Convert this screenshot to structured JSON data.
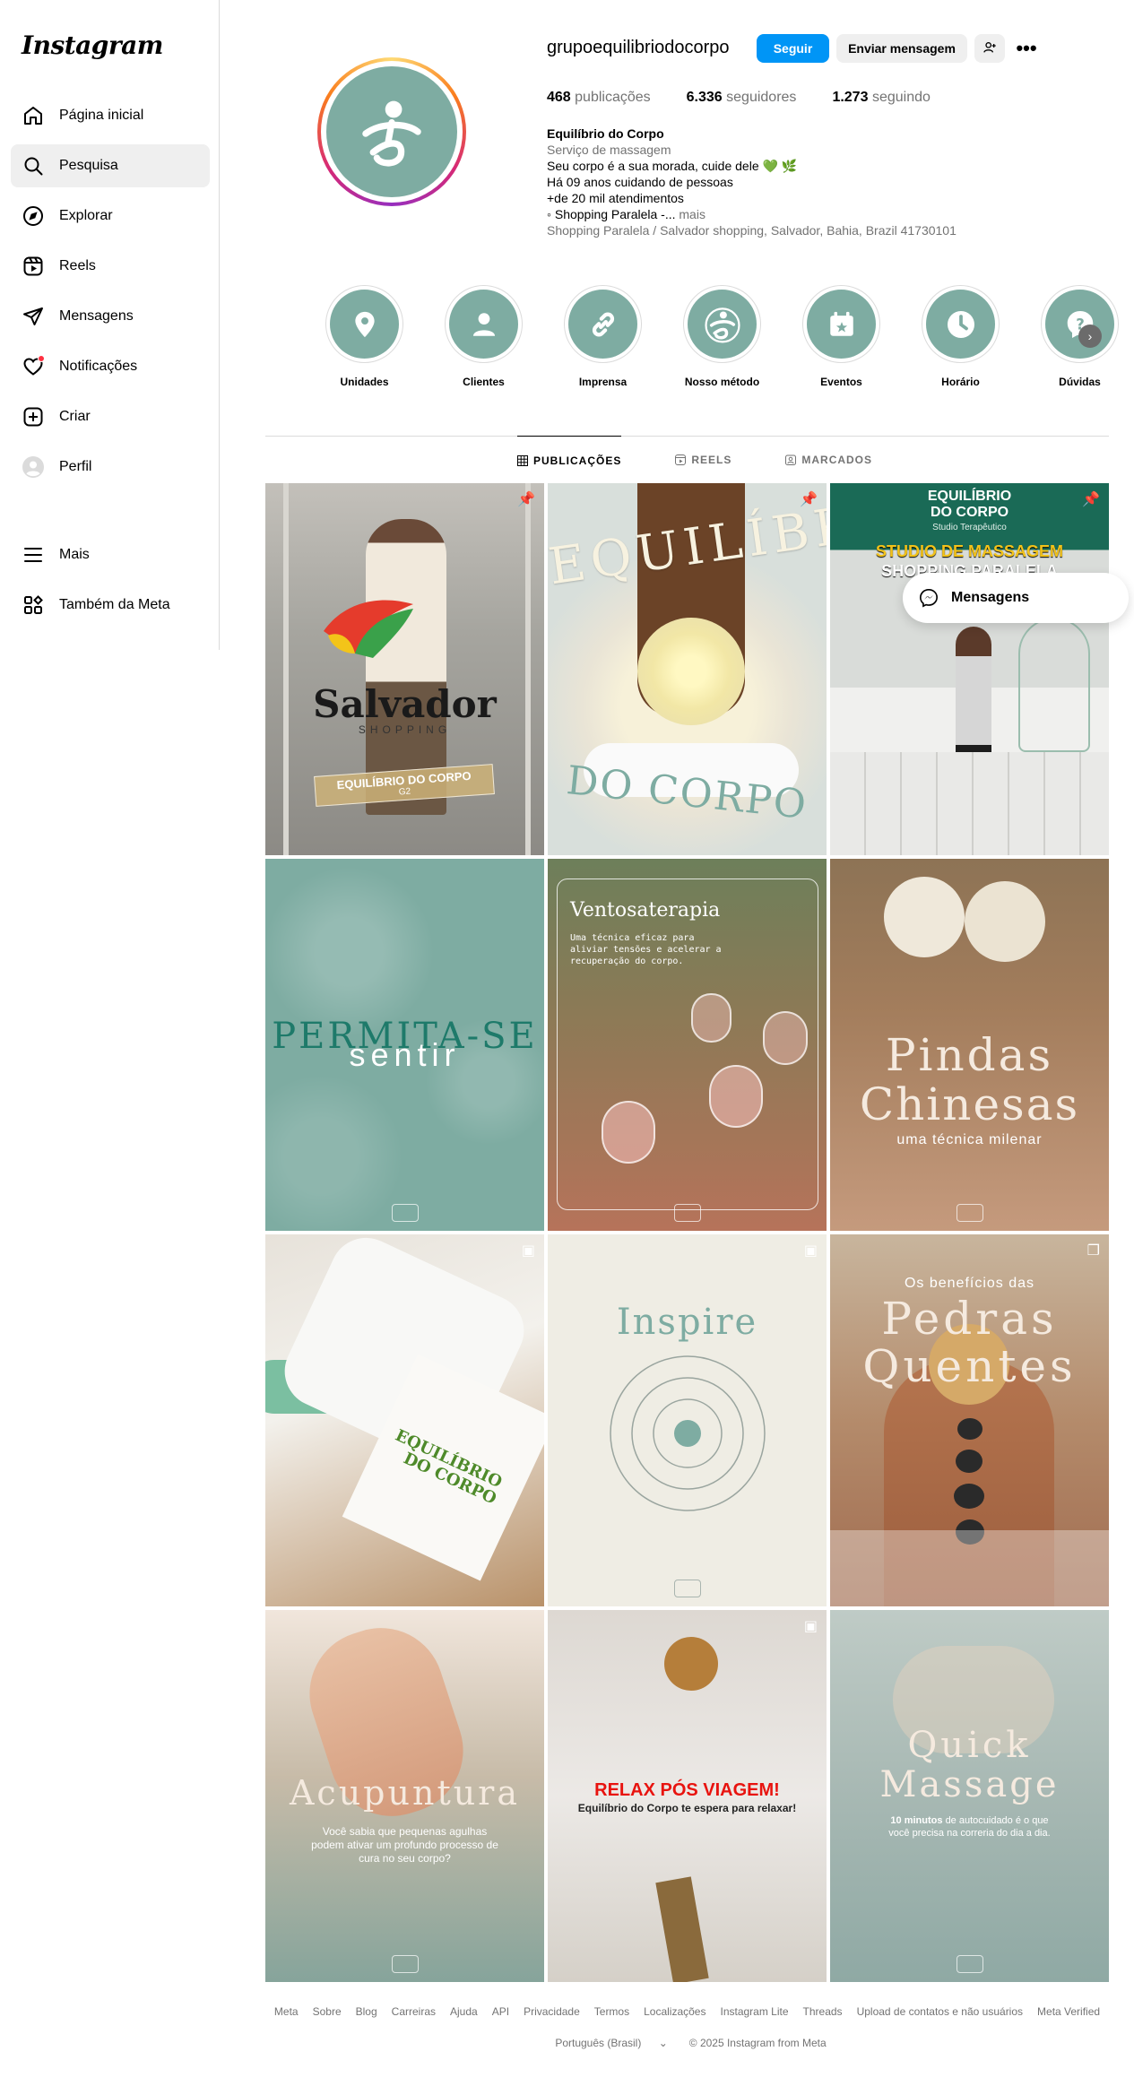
{
  "sidebar": {
    "logo": "Instagram",
    "items": [
      {
        "label": "Página inicial"
      },
      {
        "label": "Pesquisa"
      },
      {
        "label": "Explorar"
      },
      {
        "label": "Reels"
      },
      {
        "label": "Mensagens"
      },
      {
        "label": "Notificações"
      },
      {
        "label": "Criar"
      },
      {
        "label": "Perfil"
      }
    ],
    "bottom": [
      {
        "label": "Mais"
      },
      {
        "label": "Também da Meta"
      }
    ]
  },
  "profile": {
    "username": "grupoequilibriodocorpo",
    "follow_label": "Seguir",
    "message_label": "Enviar mensagem",
    "more_label": "•••",
    "stats": {
      "posts_count": "468",
      "posts_label": "publicações",
      "followers_count": "6.336",
      "followers_label": "seguidores",
      "following_count": "1.273",
      "following_label": "seguindo"
    },
    "bio": {
      "name": "Equilíbrio do Corpo",
      "category": "Serviço de massagem",
      "line1": "Seu corpo é a sua morada, cuide dele 💚 🌿",
      "line2": "Há 09 anos cuidando de pessoas",
      "line3": "+de 20 mil atendimentos",
      "line4": "◦ Shopping Paralela -...",
      "more": "mais",
      "address": "Shopping Paralela / Salvador shopping, Salvador, Bahia, Brazil 41730101"
    }
  },
  "highlights": [
    {
      "label": "Unidades",
      "icon": "location-pin-icon"
    },
    {
      "label": "Clientes",
      "icon": "person-icon"
    },
    {
      "label": "Imprensa",
      "icon": "link-icon"
    },
    {
      "label": "Nosso método",
      "icon": "brand-logo-icon"
    },
    {
      "label": "Eventos",
      "icon": "calendar-star-icon"
    },
    {
      "label": "Horário",
      "icon": "clock-icon"
    },
    {
      "label": "Dúvidas",
      "icon": "question-bubble-icon"
    }
  ],
  "tabs": [
    {
      "label": "PUBLICAÇÕES"
    },
    {
      "label": "REELS"
    },
    {
      "label": "MARCADOS"
    }
  ],
  "posts": {
    "p1": {
      "brand": "Salvador",
      "sub": "SHOPPING",
      "badge": "EQUILÍBRIO DO CORPO",
      "badge_sub": "G2"
    },
    "p2": {
      "top": "EQUILÍBRIO",
      "bottom": "DO CORPO"
    },
    "p3": {
      "top1": "EQUILÍBRIO",
      "top2": "DO CORPO",
      "top3": "Studio Terapêutico",
      "banner1": "STUDIO DE MASSAGEM",
      "banner2": "SHOPPING PARALELA"
    },
    "p4": {
      "t1": "PERMITA-SE",
      "t2": "sentir"
    },
    "p5": {
      "title": "Ventosaterapia",
      "desc": "Uma técnica eficaz para aliviar tensões e acelerar a recuperação do corpo."
    },
    "p6": {
      "t1": "Pindas",
      "t2": "Chinesas",
      "t3": "uma técnica milenar"
    },
    "p7": {
      "t1": "EQUILÍBRIO",
      "t2": "DO CORPO"
    },
    "p8": {
      "title": "Inspire"
    },
    "p9": {
      "t0": "Os benefícios das",
      "t1": "Pedras",
      "t2": "Quentes"
    },
    "p10": {
      "title": "Acupuntura",
      "desc": "Você sabia que pequenas agulhas podem ativar um profundo processo de cura no seu corpo?"
    },
    "p11": {
      "t1": "RELAX PÓS VIAGEM!",
      "t2": "Equilíbrio do Corpo te espera para relaxar!"
    },
    "p12": {
      "t1": "Quick",
      "t2": "Massage",
      "desc_bold": "10 minutos",
      "desc": "de autocuidado é o que você precisa na correria do dia a dia."
    }
  },
  "floating_messages": {
    "label": "Mensagens"
  },
  "footer": {
    "links": [
      "Meta",
      "Sobre",
      "Blog",
      "Carreiras",
      "Ajuda",
      "API",
      "Privacidade",
      "Termos",
      "Localizações",
      "Instagram Lite",
      "Threads",
      "Upload de contatos e não usuários",
      "Meta Verified"
    ],
    "language": "Português (Brasil)",
    "copyright": "© 2025 Instagram from Meta"
  },
  "colors": {
    "accent": "#0095f6",
    "brand_teal": "#7eaca2",
    "notification": "#ff3040"
  }
}
